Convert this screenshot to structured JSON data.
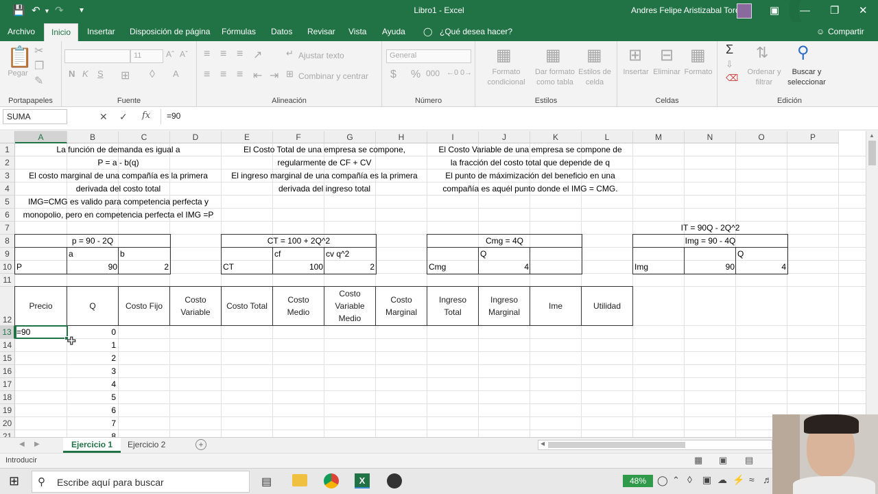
{
  "window": {
    "title": "Libro1 - Excel",
    "user": "Andres Felipe Aristizabal Toro"
  },
  "ribbon_tabs": [
    "Archivo",
    "Inicio",
    "Insertar",
    "Disposición de página",
    "Fórmulas",
    "Datos",
    "Revisar",
    "Vista",
    "Ayuda"
  ],
  "tell_me": "¿Qué desea hacer?",
  "share": "Compartir",
  "ribbon": {
    "clipboard": {
      "paste": "Pegar",
      "group": "Portapapeles"
    },
    "font": {
      "size": "11",
      "bold": "N",
      "italic": "K",
      "underline": "S",
      "group": "Fuente"
    },
    "alignment": {
      "wrap": "Ajustar texto",
      "merge": "Combinar y centrar",
      "group": "Alineación"
    },
    "number": {
      "format": "General",
      "group": "Número"
    },
    "styles": {
      "cond1": "Formato",
      "cond2": "condicional",
      "table1": "Dar formato",
      "table2": "como tabla",
      "cell1": "Estilos de",
      "cell2": "celda",
      "group": "Estilos"
    },
    "cells": {
      "insert": "Insertar",
      "delete": "Eliminar",
      "format": "Formato",
      "group": "Celdas"
    },
    "editing": {
      "sort1": "Ordenar y",
      "sort2": "filtrar",
      "find1": "Buscar y",
      "find2": "seleccionar",
      "group": "Edición"
    }
  },
  "formula_bar": {
    "name_box": "SUMA",
    "formula": "=90"
  },
  "columns": [
    "A",
    "B",
    "C",
    "D",
    "E",
    "F",
    "G",
    "H",
    "I",
    "J",
    "K",
    "L",
    "M",
    "N",
    "O",
    "P"
  ],
  "rows": [
    "1",
    "2",
    "3",
    "4",
    "5",
    "6",
    "7",
    "8",
    "9",
    "10",
    "11",
    "12",
    "13",
    "14",
    "15",
    "16",
    "17",
    "18",
    "19",
    "20",
    "21"
  ],
  "cells": {
    "A1": "La función de demanda es igual a",
    "A2": "P = a - b(q)",
    "A3": "El costo marginal de una compañía es la primera",
    "A4": "derivada del costo total",
    "A5": "IMG=CMG es valido para competencia perfecta y",
    "A6": "monopolio, pero en competencia perfecta el IMG =P",
    "E1": "El Costo Total de una empresa se compone,",
    "E2": "regularmente de CF + CV",
    "E3": "El ingreso marginal de una compañía es la primera",
    "E4": "derivada del ingreso total",
    "I1": "El Costo Variable de una empresa se compone de",
    "I2": "la fracción del costo total que depende de q",
    "I3": "El punto de máximización del beneficio en una",
    "I4": "compañía es aquél punto donde el IMG = CMG.",
    "N7": "IT = 90Q - 2Q^2",
    "A8": "p = 90 - 2Q",
    "B9": "a",
    "C9": "b",
    "A10": "P",
    "B10": "90",
    "C10": "2",
    "E8": "CT = 100 + 2Q^2",
    "F9": "cf",
    "G9": "cv q^2",
    "E10": "CT",
    "F10": "100",
    "G10": "2",
    "I8": "Cmg = 4Q",
    "J9": "Q",
    "I10": "Cmg",
    "J10": "4",
    "M8": "Img = 90 - 4Q",
    "O9": "Q",
    "M10": "Img",
    "N10": "90",
    "O10": "4",
    "A13": "=90"
  },
  "table_headers": [
    "Precio",
    "Q",
    "Costo Fijo",
    "Costo\nVariable",
    "Costo Total",
    "Costo\nMedio",
    "Costo\nVariable\nMedio",
    "Costo\nMarginal",
    "Ingreso\nTotal",
    "Ingreso\nMarginal",
    "Ime",
    "Utilidad"
  ],
  "q_values": [
    "0",
    "1",
    "2",
    "3",
    "4",
    "5",
    "6",
    "7",
    "8"
  ],
  "sheets": [
    "Ejercicio 1",
    "Ejercicio 2"
  ],
  "status": "Introducir",
  "taskbar": {
    "search": "Escribe aquí para buscar",
    "battery": "48%"
  },
  "colors": {
    "excel_green": "#217346"
  }
}
